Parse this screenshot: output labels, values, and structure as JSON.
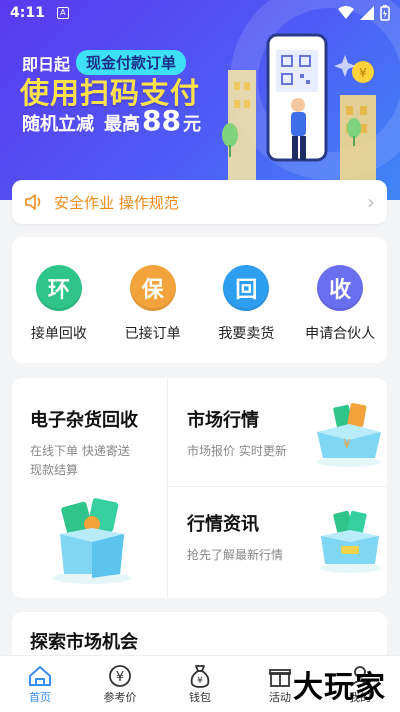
{
  "status_bar": {
    "time": "4:11",
    "notification_badge": "A"
  },
  "banner": {
    "prefix": "即日起",
    "pill": "现金付款订单",
    "headline": "使用扫码支付",
    "sub_a": "随机立减",
    "sub_b": "最高",
    "amount": "88",
    "unit": "元"
  },
  "notice": {
    "text": "安全作业 操作规范"
  },
  "quick_actions": [
    {
      "glyph": "环",
      "label": "接单回收",
      "color": "#2fc58a"
    },
    {
      "glyph": "保",
      "label": "已接订单",
      "color": "#f2a33c"
    },
    {
      "glyph": "回",
      "label": "我要卖货",
      "color": "#2e9ef0"
    },
    {
      "glyph": "收",
      "label": "申请合伙人",
      "color": "#6a6ff0"
    }
  ],
  "features": {
    "left": {
      "title": "电子杂货回收",
      "sub1": "在线下单 快递寄送",
      "sub2": "现款结算"
    },
    "top_right": {
      "title": "市场行情",
      "sub": "市场报价 实时更新"
    },
    "bottom_right": {
      "title": "行情资讯",
      "sub": "抢先了解最新行情"
    }
  },
  "explore": {
    "title": "探索市场机会"
  },
  "bottom_nav": [
    {
      "label": "首页",
      "icon": "home-icon",
      "active": true
    },
    {
      "label": "参考价",
      "icon": "yen-circle-icon",
      "active": false
    },
    {
      "label": "钱包",
      "icon": "wallet-bag-icon",
      "active": false
    },
    {
      "label": "活动",
      "icon": "gift-icon",
      "active": false
    },
    {
      "label": "我的",
      "icon": "user-icon",
      "active": false
    }
  ],
  "watermark": "大玩家",
  "colors": {
    "accent": "#3a8cf6",
    "notice": "#f08c1e",
    "headline": "#ffe24a"
  }
}
